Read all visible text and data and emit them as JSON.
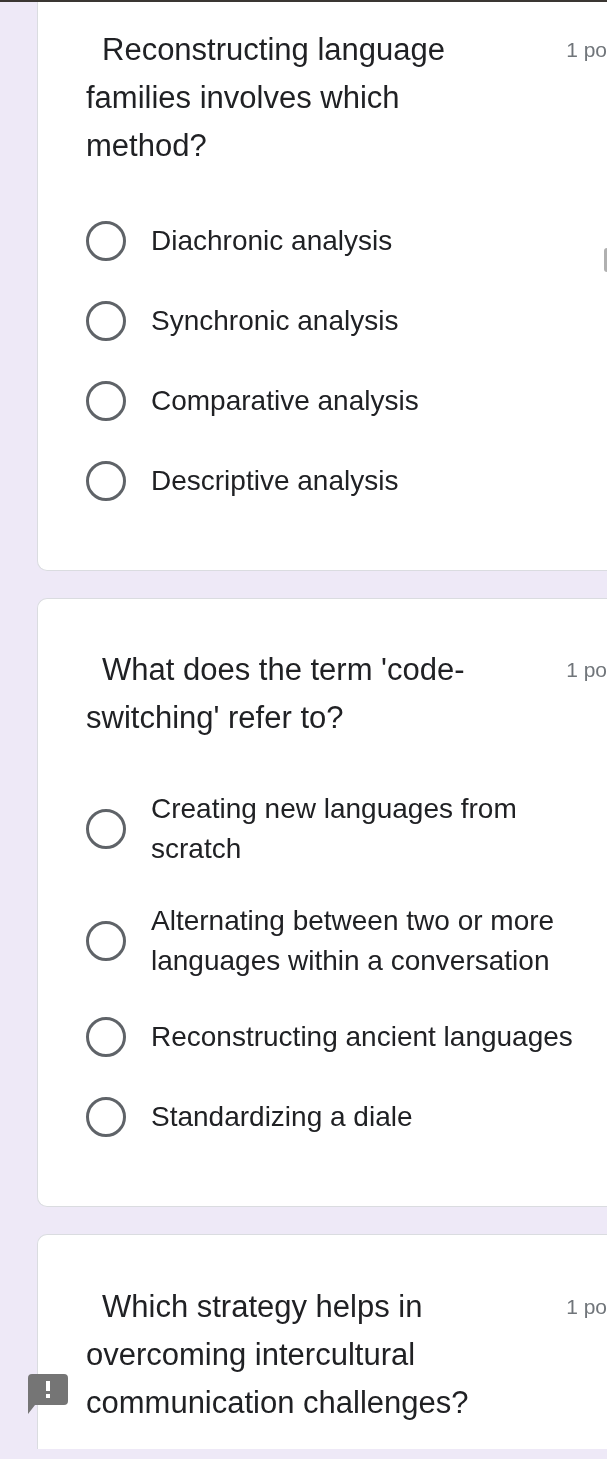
{
  "questions": [
    {
      "text": "Reconstructing language families involves which method?",
      "points": "1 po",
      "options": [
        {
          "label": "Diachronic analysis",
          "selected": false
        },
        {
          "label": "Synchronic analysis",
          "selected": false
        },
        {
          "label": "Comparative analysis",
          "selected": false
        },
        {
          "label": "Descriptive analysis",
          "selected": false
        }
      ]
    },
    {
      "text": "What does the term 'code-switching' refer to?",
      "points": "1 po",
      "options": [
        {
          "label": "Creating new languages from scratch",
          "selected": false
        },
        {
          "label": "Alternating between two or more languages within a conversation",
          "selected": false
        },
        {
          "label": "Reconstructing ancient languages",
          "selected": false
        },
        {
          "label": "Standardizing a diale",
          "selected": false
        }
      ]
    },
    {
      "text": "Which strategy helps in overcoming intercultural communication challenges?",
      "points": "1 po"
    }
  ]
}
